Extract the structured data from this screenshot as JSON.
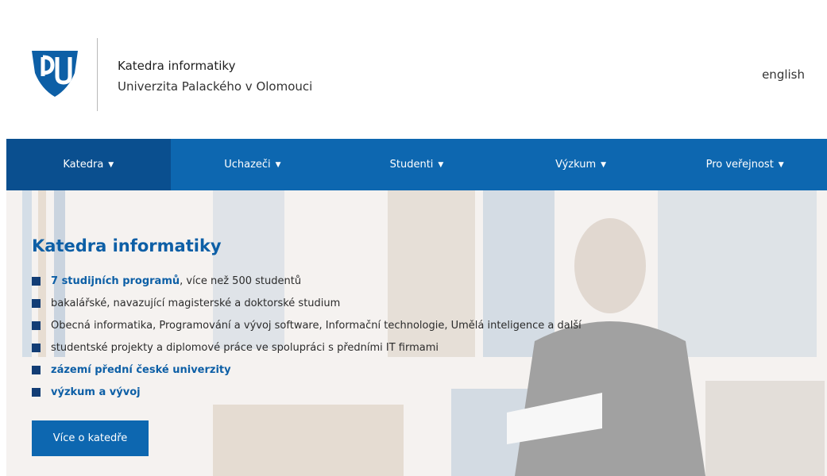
{
  "header": {
    "line1": "Katedra informatiky",
    "line2": "Univerzita Palackého v Olomouci",
    "lang": "english"
  },
  "nav": [
    {
      "label": "Katedra"
    },
    {
      "label": "Uchazeči"
    },
    {
      "label": "Studenti"
    },
    {
      "label": "Výzkum"
    },
    {
      "label": "Pro veřejnost"
    }
  ],
  "hero": {
    "title": "Katedra informatiky",
    "bullets": {
      "b1_link": "7 studijních programů",
      "b1_text": ", více než 500 studentů",
      "b2": "bakalářské, navazující magisterské a doktorské studium",
      "b3": "Obecná informatika, Programování a vývoj software, Informační technologie, Umělá inteligence a další",
      "b4": "studentské projekty a diplomové práce ve spolupráci s předními IT firmami",
      "b5_link": "zázemí přední české univerzity",
      "b6_link": "výzkum a vývoj"
    },
    "cta": "Více o katedře"
  },
  "colors": {
    "primary": "#0d67b0",
    "nav_active": "#0a4f8f",
    "bullet": "#123d75",
    "link": "#0d5fa6"
  },
  "icons": {
    "logo": "university-shield-icon",
    "caret": "caret-down-icon"
  }
}
